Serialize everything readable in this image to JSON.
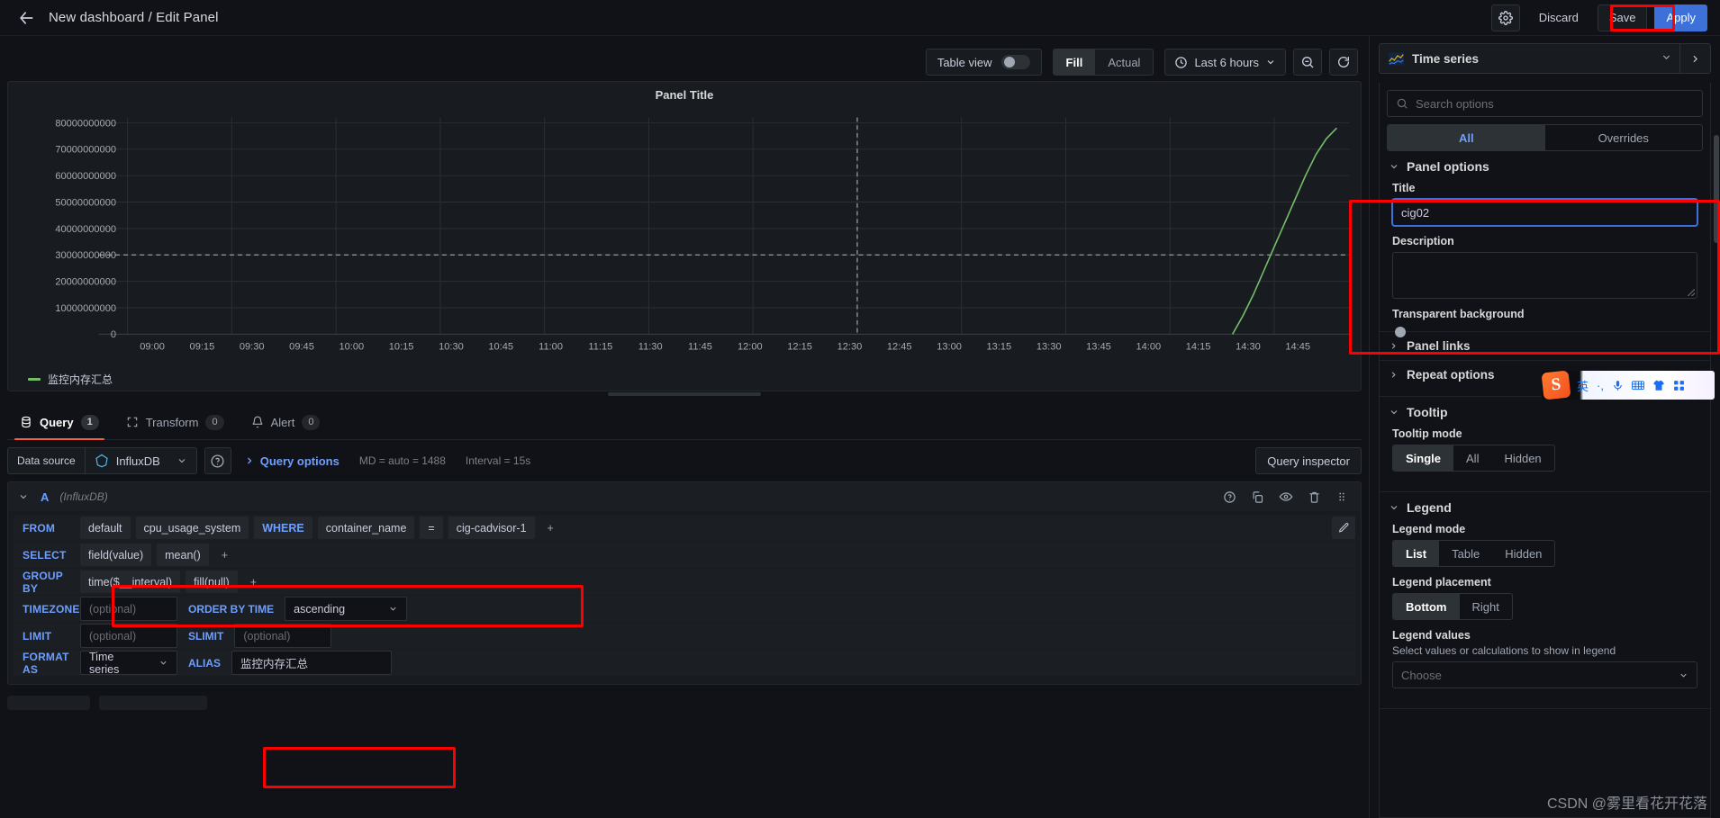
{
  "topbar": {
    "back_icon": "arrow-left-icon",
    "breadcrumb": "New dashboard / Edit Panel",
    "settings_icon": "gear-icon",
    "discard_label": "Discard",
    "save_label": "Save",
    "apply_label": "Apply"
  },
  "viz_toolbar": {
    "table_view_label": "Table view",
    "table_view_on": false,
    "fill_actual": {
      "options": [
        "Fill",
        "Actual"
      ],
      "selected": "Fill"
    },
    "time_range": "Last 6 hours",
    "clock_icon": "clock-icon",
    "zoom_out_icon": "zoom-out-icon",
    "refresh_icon": "refresh-icon"
  },
  "panel": {
    "title": "Panel Title",
    "legend_label": "监控内存汇总",
    "series_color": "#73bf69"
  },
  "chart_data": {
    "type": "line",
    "title": "Panel Title",
    "xlabel": "",
    "ylabel": "",
    "x_ticks": [
      "09:00",
      "09:15",
      "09:30",
      "09:45",
      "10:00",
      "10:15",
      "10:30",
      "10:45",
      "11:00",
      "11:15",
      "11:30",
      "11:45",
      "12:00",
      "12:15",
      "12:30",
      "12:45",
      "13:00",
      "13:15",
      "13:30",
      "13:45",
      "14:00",
      "14:15",
      "14:30",
      "14:45"
    ],
    "y_ticks": [
      0,
      10000000000,
      20000000000,
      30000000000,
      40000000000,
      50000000000,
      60000000000,
      70000000000,
      80000000000
    ],
    "y_tick_labels": [
      "0",
      "10000000000",
      "20000000000",
      "30000000000",
      "40000000000",
      "50000000000",
      "60000000000",
      "70000000000",
      "80000000000"
    ],
    "ylim": [
      0,
      82000000000
    ],
    "grid": true,
    "legend_position": "bottom",
    "threshold_line": {
      "value": 30000000000,
      "style": "dashed",
      "color": "#8e9099"
    },
    "cursor_line_x": "12:30",
    "series": [
      {
        "name": "监控内存汇总",
        "color": "#73bf69",
        "points": [
          {
            "x": "14:18",
            "y": 0
          },
          {
            "x": "14:21",
            "y": 7000000000
          },
          {
            "x": "14:24",
            "y": 15000000000
          },
          {
            "x": "14:27",
            "y": 24000000000
          },
          {
            "x": "14:30",
            "y": 33000000000
          },
          {
            "x": "14:33",
            "y": 42000000000
          },
          {
            "x": "14:36",
            "y": 51000000000
          },
          {
            "x": "14:39",
            "y": 60000000000
          },
          {
            "x": "14:42",
            "y": 68000000000
          },
          {
            "x": "14:45",
            "y": 74000000000
          },
          {
            "x": "14:48",
            "y": 78000000000
          }
        ]
      }
    ]
  },
  "tabs": [
    {
      "label": "Query",
      "count": "1",
      "icon": "database-icon",
      "active": true
    },
    {
      "label": "Transform",
      "count": "0",
      "icon": "transform-icon",
      "active": false
    },
    {
      "label": "Alert",
      "count": "0",
      "icon": "bell-icon",
      "active": false
    }
  ],
  "query_options": {
    "data_source_label": "Data source",
    "data_source_value": "InfluxDB",
    "help_icon": "help-circle-icon",
    "query_options_label": "Query options",
    "max_data_points": "MD = auto = 1488",
    "interval": "Interval = 15s",
    "query_inspector_label": "Query inspector"
  },
  "query_editor": {
    "ref_id": "A",
    "datasource": "(InfluxDB)",
    "actions": [
      "help-circle-icon",
      "copy-icon",
      "eye-icon",
      "trash-icon",
      "drag-handle-icon"
    ],
    "pencil_icon": "pencil-icon",
    "rows": {
      "from": {
        "key": "FROM",
        "policy": "default",
        "measurement": "cpu_usage_system",
        "where_kw": "WHERE",
        "tag_key": "container_name",
        "operator": "=",
        "tag_value": "cig-cadvisor-1",
        "add": "+"
      },
      "select": {
        "key": "SELECT",
        "field": "field(value)",
        "func": "mean()",
        "add": "+"
      },
      "group_by": {
        "key": "GROUP BY",
        "time": "time($__interval)",
        "fill": "fill(null)",
        "add": "+"
      },
      "timezone": {
        "key": "TIMEZONE",
        "placeholder": "(optional)",
        "order_key": "ORDER BY TIME",
        "order_value": "ascending"
      },
      "limit": {
        "key": "LIMIT",
        "placeholder": "(optional)",
        "slimit_key": "SLIMIT",
        "slimit_placeholder": "(optional)"
      },
      "format": {
        "key": "FORMAT AS",
        "value": "Time series",
        "alias_key": "ALIAS",
        "alias_value": "监控内存汇总"
      }
    }
  },
  "options_pane": {
    "viz_name": "Time series",
    "viz_icon": "time-series-icon",
    "search_placeholder": "Search options",
    "search_icon": "search-icon",
    "all_overrides": {
      "options": [
        "All",
        "Overrides"
      ],
      "selected": "All"
    },
    "sections": {
      "panel_options": {
        "title": "Panel options",
        "title_label": "Title",
        "title_value": "cig02",
        "description_label": "Description",
        "description_value": "",
        "transparent_label": "Transparent background",
        "transparent_on": false,
        "panel_links_label": "Panel links",
        "repeat_options_label": "Repeat options"
      },
      "tooltip": {
        "title": "Tooltip",
        "mode_label": "Tooltip mode",
        "mode_options": [
          "Single",
          "All",
          "Hidden"
        ],
        "mode_selected": "Single"
      },
      "legend": {
        "title": "Legend",
        "mode_label": "Legend mode",
        "mode_options": [
          "List",
          "Table",
          "Hidden"
        ],
        "mode_selected": "List",
        "placement_label": "Legend placement",
        "placement_options": [
          "Bottom",
          "Right"
        ],
        "placement_selected": "Bottom",
        "values_label": "Legend values",
        "values_desc": "Select values or calculations to show in legend",
        "values_placeholder": "Choose"
      }
    }
  },
  "ime": {
    "logo": "S",
    "items": [
      "英",
      "·,",
      "mic-icon",
      "keyboard-icon",
      "skin-icon",
      "apps-icon"
    ]
  },
  "watermark": "CSDN @雾里看花开花落"
}
